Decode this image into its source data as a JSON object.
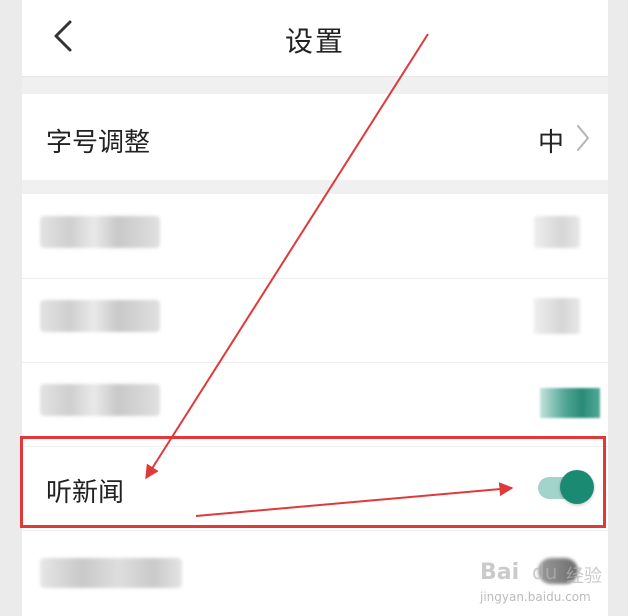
{
  "header": {
    "title": "设置",
    "back_icon": "chevron-left-icon"
  },
  "font_size": {
    "label": "字号调整",
    "value": "中",
    "chevron_icon": "chevron-right-icon"
  },
  "news": {
    "label": "听新闻",
    "toggle_on": true,
    "toggle_color": "#1b8a73",
    "track_color": "#a3d4cb"
  },
  "annotation": {
    "highlight_color": "#e0393a"
  },
  "watermark": {
    "logo": "Bai",
    "paw": "du",
    "cn": "经验",
    "url": "jingyan.baidu.com"
  }
}
